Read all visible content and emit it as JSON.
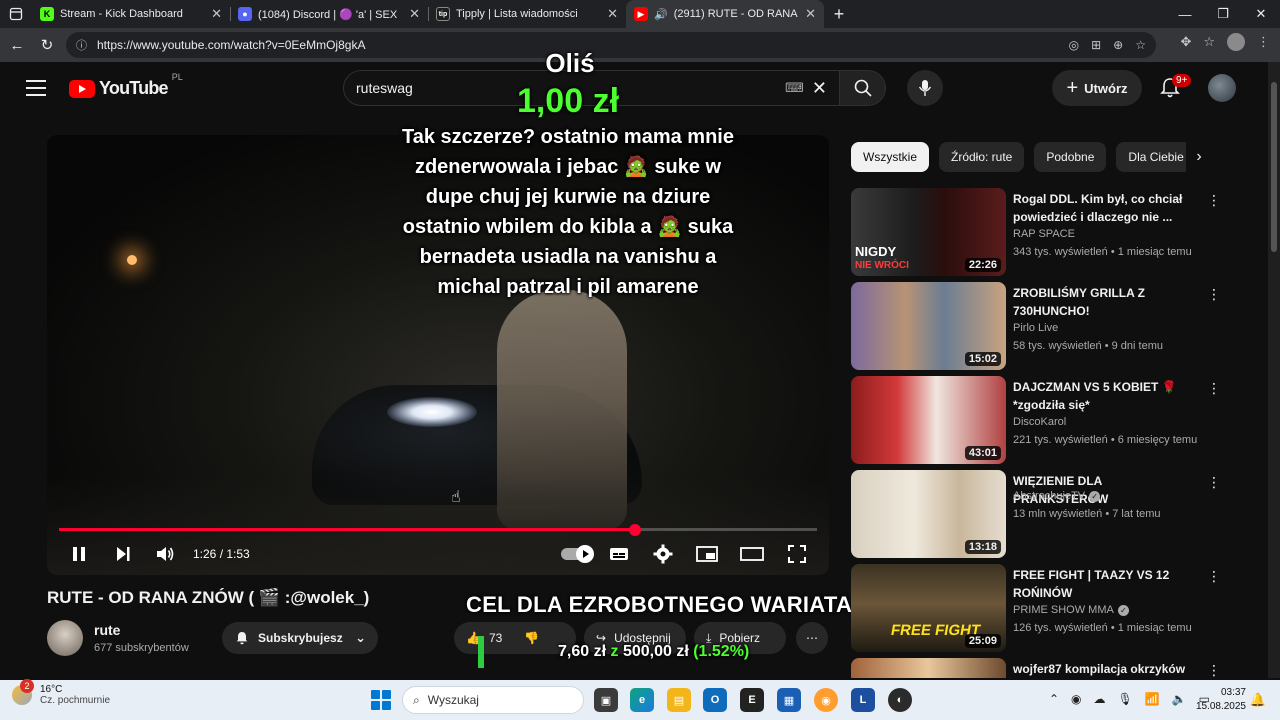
{
  "browser": {
    "tabs": [
      {
        "title": "Stream - Kick Dashboard",
        "favicon": "kick-icon",
        "color": "#53fc18",
        "active": false
      },
      {
        "title": "(1084) Discord | 🟣 'a' | SEX",
        "favicon": "discord-icon",
        "color": "#5865f2",
        "active": false
      },
      {
        "title": "Tipply | Lista wiadomości",
        "favicon": "tipply-icon",
        "color": "#1e1e1e",
        "active": false
      },
      {
        "title": "(2911) RUTE - OD RANA ZNÓ",
        "favicon": "youtube-icon",
        "color": "#ff0000",
        "active": true
      }
    ],
    "url": "https://www.youtube.com/watch?v=0EeMmOj8gkA"
  },
  "youtube": {
    "logo_text": "YouTube",
    "country_code": "PL",
    "search_query": "ruteswag",
    "create_label": "Utwórz",
    "notifications_badge": "9+"
  },
  "player": {
    "current_time": "1:26",
    "separator": " / ",
    "duration": "1:53",
    "progress_fraction": 0.76
  },
  "donation_alert": {
    "name": "Oliś",
    "amount": "1,00 zł",
    "message": "Tak szczerze? ostatnio mama mnie zdenerwowala i jebac 🧟 suke w dupe chuj jej kurwie na dziure ostatnio wbilem do kibla a 🧟 suka bernadeta usiadla na vanishu a michal patrzal i pil amarene"
  },
  "video": {
    "title": "RUTE - OD RANA ZNÓW ( 🎬 :@wolek_)",
    "channel": "rute",
    "subscribers": "677 subskrybentów",
    "subscribe_label": "Subskrybujesz",
    "likes": "73",
    "share_label": "Udostępnij",
    "download_label": "Pobierz"
  },
  "goal": {
    "title": "CEL DLA EZROBOTNEGO WARIATA",
    "current": "7,60 zł",
    "of": "z",
    "target": "500,00 zł",
    "percent": "(1.52%)",
    "fraction": 0.0152
  },
  "chips": [
    "Wszystkie",
    "Źródło: rute",
    "Podobne",
    "Dla Ciebie"
  ],
  "related": [
    {
      "title": "Rogal DDL. Kim był, co chciał powiedzieć i dlaczego nie ...",
      "channel": "RAP SPACE",
      "meta": "343 tys. wyświetleń • 1 miesiąc temu",
      "duration": "22:26",
      "verified": false,
      "thumb_text": "NIGDY",
      "thumb_text2": "NIE WRÓCI"
    },
    {
      "title": "ZROBILIŚMY GRILLA Z 730HUNCHO!",
      "channel": "Pirlo Live",
      "meta": "58 tys. wyświetleń • 9 dni temu",
      "duration": "15:02",
      "verified": false,
      "thumb_text": "",
      "thumb_text2": ""
    },
    {
      "title": "DAJCZMAN VS 5 KOBIET 🌹 *zgodziła się*",
      "channel": "DiscoKarol",
      "meta": "221 tys. wyświetleń • 6 miesięcy temu",
      "duration": "43:01",
      "verified": false,
      "thumb_text": "",
      "thumb_text2": ""
    },
    {
      "title": "WIĘZIENIE DLA PRANKSTERÓW",
      "channel": "AbstrachujeTV",
      "meta": "13 mln wyświetleń • 7 lat temu",
      "duration": "13:18",
      "verified": true,
      "thumb_text": "",
      "thumb_text2": ""
    },
    {
      "title": "FREE FIGHT | TAAZY VS 12 ROŃINÓW",
      "channel": "PRIME SHOW MMA",
      "meta": "126 tys. wyświetleń • 1 miesiąc temu",
      "duration": "25:09",
      "verified": true,
      "thumb_text": "FREE FIGHT",
      "thumb_text2": ""
    },
    {
      "title": "wojfer87 kompilacja okrzyków",
      "channel": "",
      "meta": "",
      "duration": "",
      "verified": false,
      "thumb_text": "",
      "thumb_text2": ""
    }
  ],
  "taskbar": {
    "weather_temp": "16°C",
    "weather_desc": "Cz. pochmurnie",
    "weather_badge": "2",
    "search_placeholder": "Wyszukaj",
    "time": "03:37",
    "date": "15.08.2025"
  }
}
